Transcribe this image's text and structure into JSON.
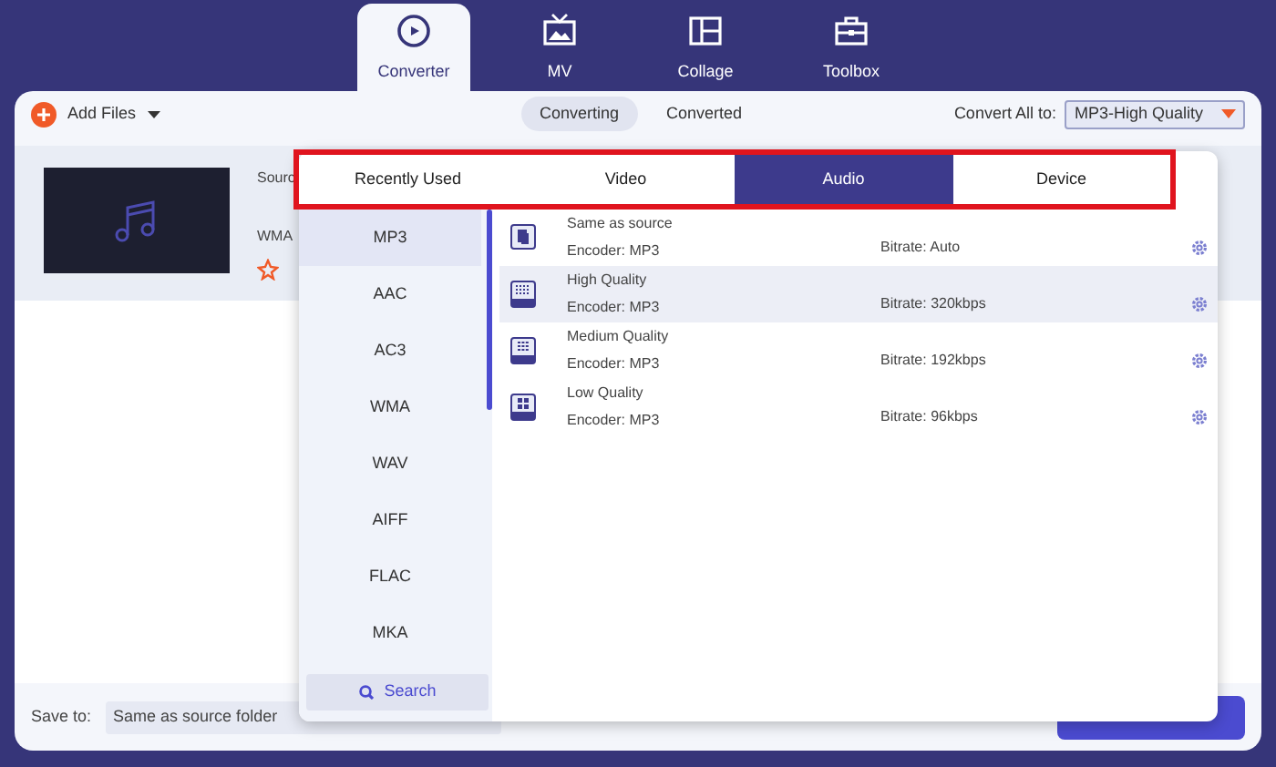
{
  "nav_tabs": [
    {
      "label": "Converter",
      "kind": "converter",
      "selected": true
    },
    {
      "label": "MV",
      "kind": "mv",
      "selected": false
    },
    {
      "label": "Collage",
      "kind": "collage",
      "selected": false
    },
    {
      "label": "Toolbox",
      "kind": "toolbox",
      "selected": false
    }
  ],
  "toolbar": {
    "add_files": "Add Files",
    "view_tabs": [
      {
        "label": "Converting",
        "selected": true
      },
      {
        "label": "Converted",
        "selected": false
      }
    ],
    "convert_all_label": "Convert All to:",
    "convert_all_value": "MP3-High Quality"
  },
  "file_item": {
    "source_label": "Sourc",
    "format": "WMA"
  },
  "format_popup": {
    "tabs": [
      {
        "label": "Recently Used",
        "selected": false
      },
      {
        "label": "Video",
        "selected": false
      },
      {
        "label": "Audio",
        "selected": true
      },
      {
        "label": "Device",
        "selected": false
      }
    ],
    "formats": [
      {
        "label": "MP3",
        "selected": true
      },
      {
        "label": "AAC",
        "selected": false
      },
      {
        "label": "AC3",
        "selected": false
      },
      {
        "label": "WMA",
        "selected": false
      },
      {
        "label": "WAV",
        "selected": false
      },
      {
        "label": "AIFF",
        "selected": false
      },
      {
        "label": "FLAC",
        "selected": false
      },
      {
        "label": "MKA",
        "selected": false
      }
    ],
    "search_label": "Search",
    "presets": [
      {
        "kind": "source",
        "name": "Same as source",
        "encoder": "Encoder: MP3",
        "bitrate": "Bitrate: Auto",
        "selected": false
      },
      {
        "kind": "high",
        "name": "High Quality",
        "encoder": "Encoder: MP3",
        "bitrate": "Bitrate: 320kbps",
        "selected": true
      },
      {
        "kind": "medium",
        "name": "Medium Quality",
        "encoder": "Encoder: MP3",
        "bitrate": "Bitrate: 192kbps",
        "selected": false
      },
      {
        "kind": "low",
        "name": "Low Quality",
        "encoder": "Encoder: MP3",
        "bitrate": "Bitrate: 96kbps",
        "selected": false
      }
    ]
  },
  "bottom_bar": {
    "save_to_label": "Save to:",
    "save_to_value": "Same as source folder"
  }
}
